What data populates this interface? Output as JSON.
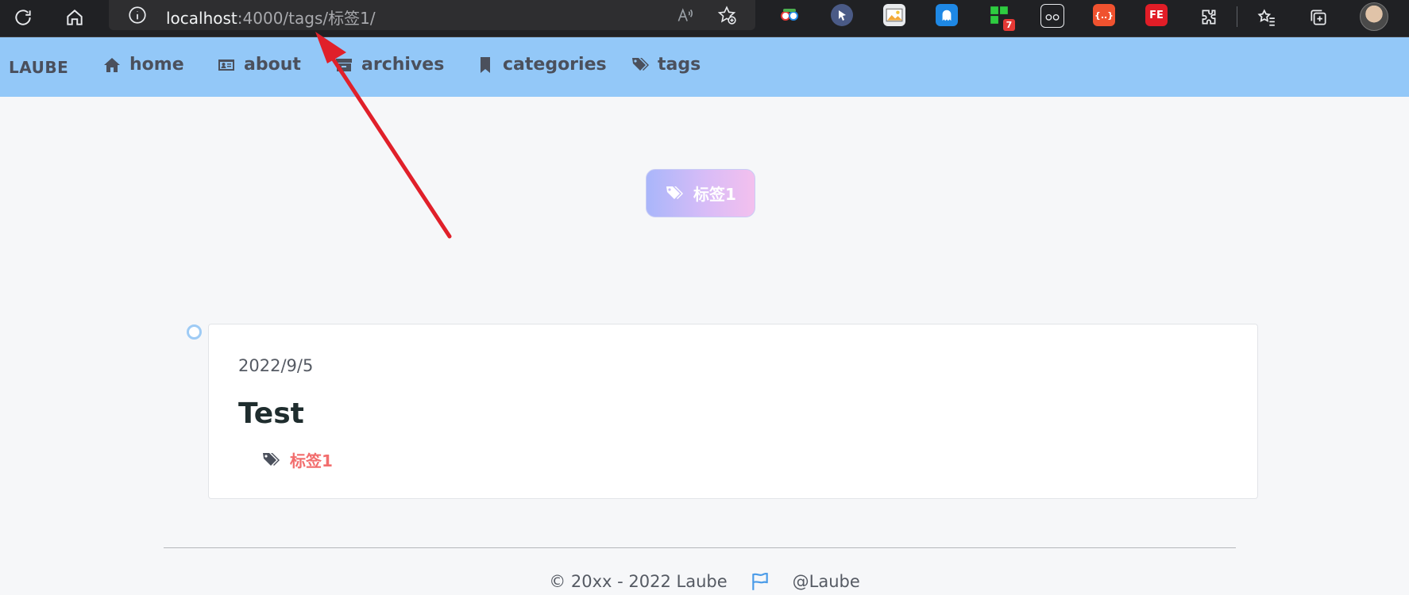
{
  "browser": {
    "url_host": "localhost",
    "url_path": ":4000/tags/标签1/",
    "icons": [
      "refresh-icon",
      "home-icon",
      "info-icon",
      "read-aloud-icon",
      "add-favorite-icon"
    ],
    "extension_badge": "7",
    "extension_fe_label": "FE",
    "extension_braces_label": "{..}"
  },
  "nav": {
    "brand": "LAUBE",
    "items": [
      {
        "label": "home",
        "icon": "home-icon"
      },
      {
        "label": "about",
        "icon": "id-card-icon"
      },
      {
        "label": "archives",
        "icon": "archive-box-icon"
      },
      {
        "label": "categories",
        "icon": "bookmark-icon"
      },
      {
        "label": "tags",
        "icon": "tags-icon"
      }
    ]
  },
  "tag_header": {
    "label": "标签1",
    "icon": "tags-icon"
  },
  "posts": [
    {
      "date": "2022/9/5",
      "title": "Test",
      "tag": "标签1"
    }
  ],
  "footer": {
    "copyright": "© 20xx - 2022 Laube",
    "author": "@Laube",
    "flag_icon": "flag-icon"
  },
  "colors": {
    "nav_bg": "#93c8f8",
    "tag_link": "#f26d6d",
    "annotation_arrow": "#e0202a"
  }
}
